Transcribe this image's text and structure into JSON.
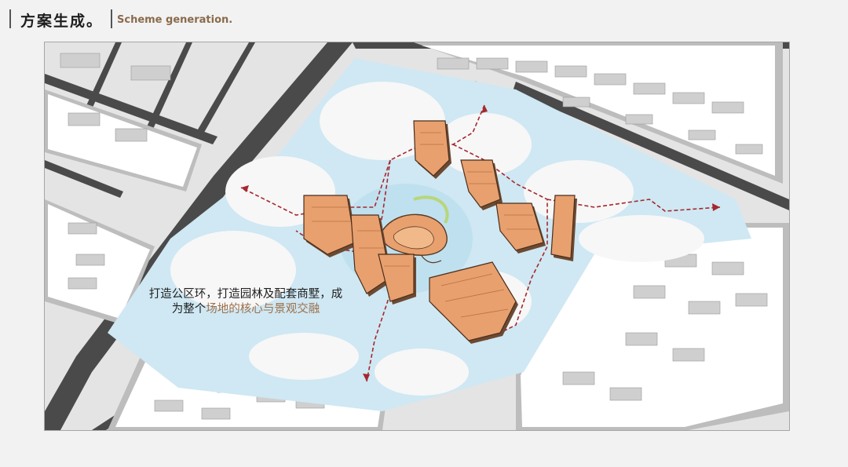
{
  "header": {
    "title_cn": "方案生成。",
    "title_en": "Scheme generation."
  },
  "caption": {
    "line1": "打造公区环，打造园林及配套商墅，成",
    "line2_plain": "为整个",
    "line2_highlight": "场地的核心与景观交融"
  },
  "colors": {
    "accent_text": "#8a6a4c",
    "building_orange": "#e8a06e",
    "water_blue": "#cfe8f3",
    "path_red": "#a6282e"
  },
  "icons": [
    "route-arrow-icon"
  ]
}
